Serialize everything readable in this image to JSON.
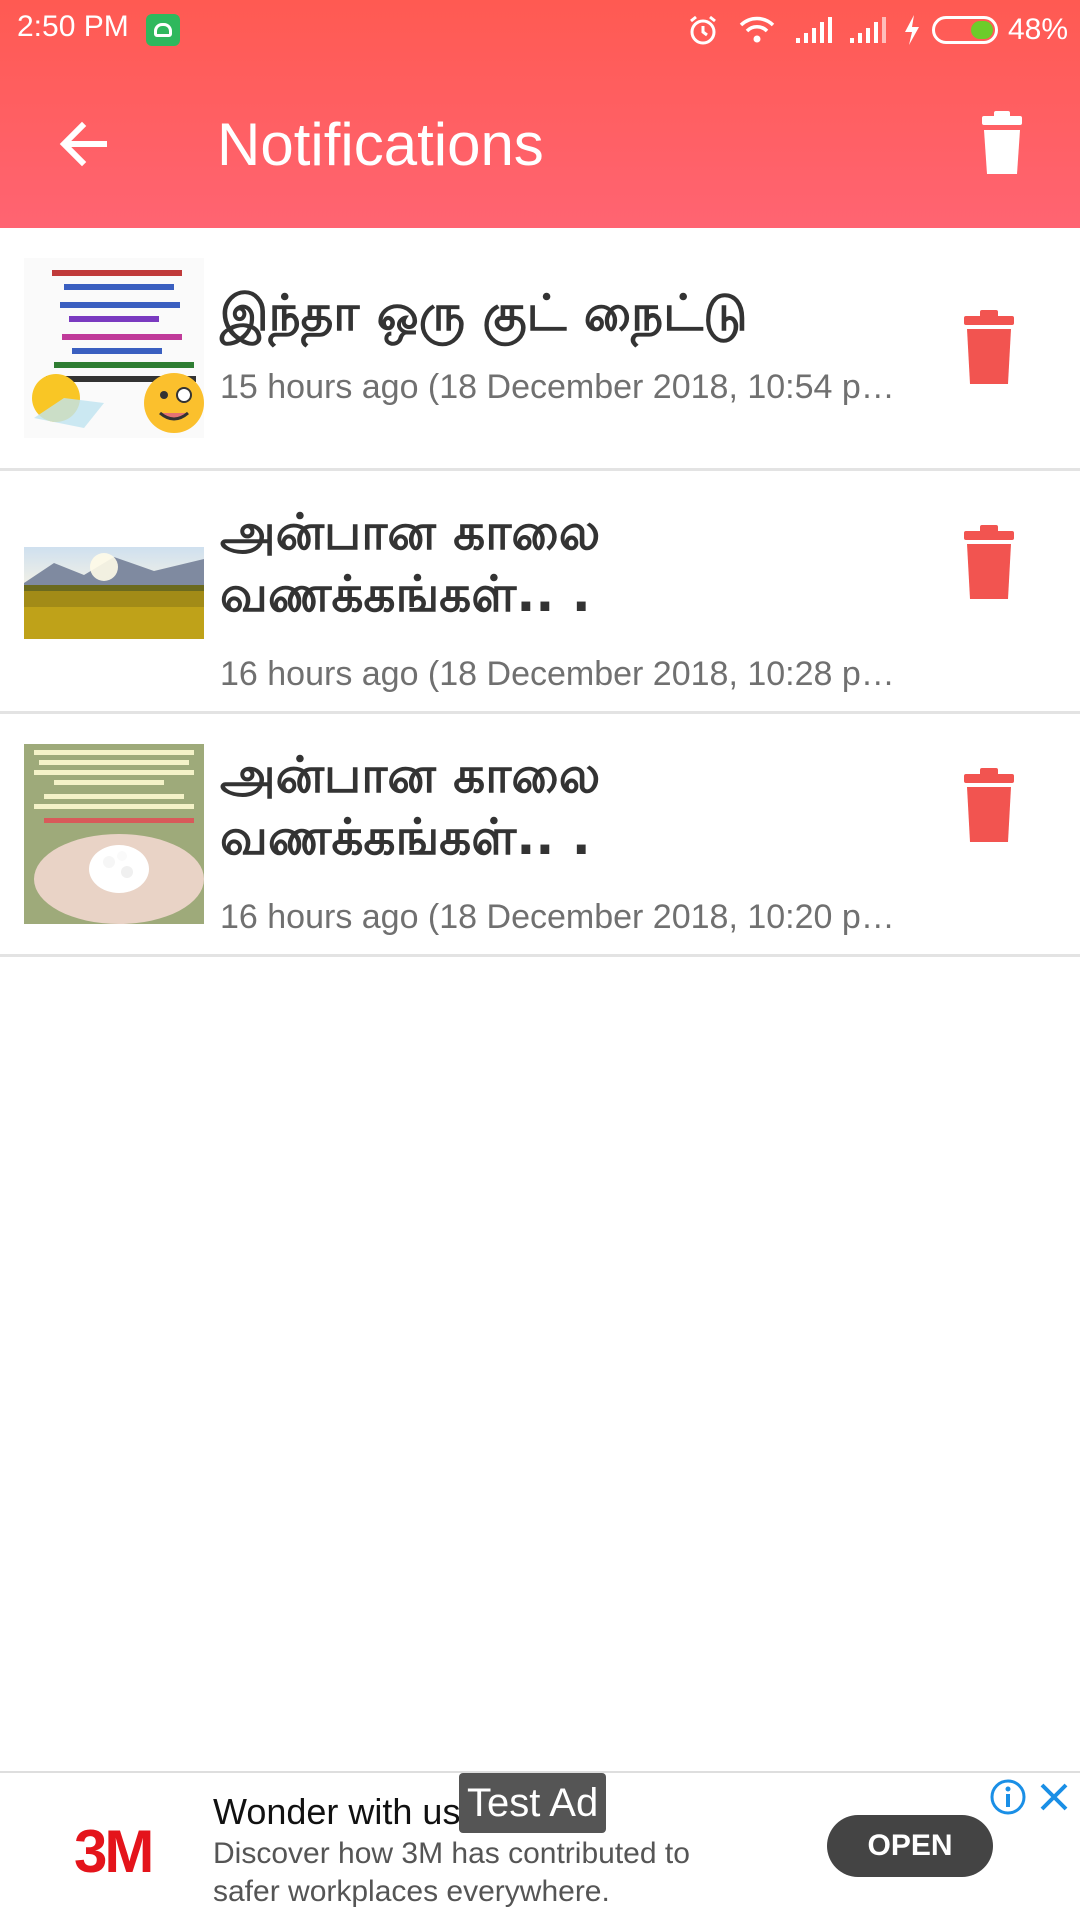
{
  "status_bar": {
    "time": "2:50 PM",
    "battery_percent": "48%",
    "battery_level": 0.48,
    "icons": [
      "android-notification-icon",
      "alarm-icon",
      "wifi-icon",
      "signal-icon",
      "signal-icon",
      "charging-icon",
      "battery-icon"
    ]
  },
  "header": {
    "title": "Notifications",
    "back_icon": "arrow-left-icon",
    "delete_all_icon": "trash-icon",
    "accent": "#ff5f5f"
  },
  "notifications": [
    {
      "title": "இந்தா ஒரு குட் நைட்டு",
      "time": "15 hours ago (18 December 2018, 10:54 p…"
    },
    {
      "title": "அன்பான காலை வணக்கங்கள்.. .",
      "time": "16 hours ago (18 December 2018, 10:28 p…"
    },
    {
      "title": "அன்பான காலை வணக்கங்கள்.. .",
      "time": "16 hours ago (18 December 2018, 10:20 p…"
    }
  ],
  "ad": {
    "brand": "3M",
    "title": "Wonder with us",
    "badge": "Test Ad",
    "description": "Discover how 3M has contributed to safer workplaces everywhere.",
    "cta": "OPEN"
  }
}
